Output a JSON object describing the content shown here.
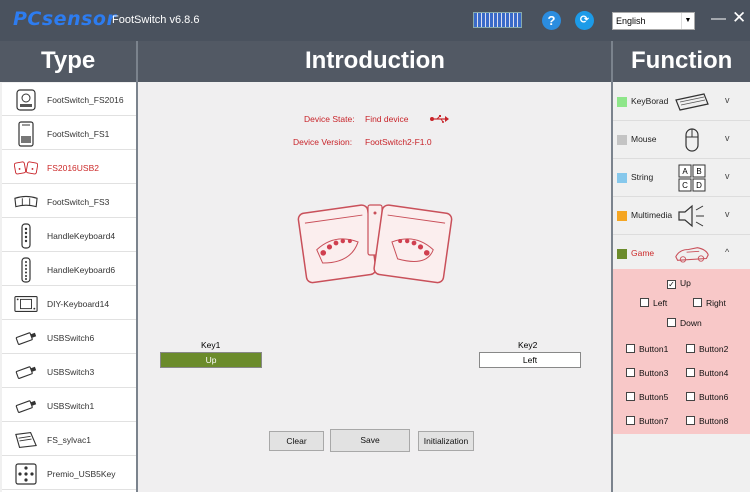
{
  "app": {
    "logo": "PCsensor",
    "title": "FootSwitch v6.8.6",
    "language": "English"
  },
  "headings": {
    "type": "Type",
    "introduction": "Introduction",
    "function": "Function"
  },
  "types": [
    {
      "label": "FootSwitch_FS2016",
      "icon": "footswitch-fs2016-icon"
    },
    {
      "label": "FootSwitch_FS1",
      "icon": "footswitch-fs1-icon"
    },
    {
      "label": "FS2016USB2",
      "icon": "fs2016usb2-icon",
      "selected": true
    },
    {
      "label": "FootSwitch_FS3",
      "icon": "footswitch-fs3-icon"
    },
    {
      "label": "HandleKeyboard4",
      "icon": "handlekeyboard4-icon"
    },
    {
      "label": "HandleKeyboard6",
      "icon": "handlekeyboard6-icon"
    },
    {
      "label": "DIY-Keyboard14",
      "icon": "diy-keyboard14-icon"
    },
    {
      "label": "USBSwitch6",
      "icon": "usbswitch6-icon"
    },
    {
      "label": "USBSwitch3",
      "icon": "usbswitch3-icon"
    },
    {
      "label": "USBSwitch1",
      "icon": "usbswitch1-icon"
    },
    {
      "label": "FS_sylvac1",
      "icon": "fs-sylvac1-icon"
    },
    {
      "label": "Premio_USB5Key",
      "icon": "premio-usb5key-icon"
    }
  ],
  "device": {
    "state_label": "Device State:",
    "state_value": "Find device",
    "version_label": "Device Version:",
    "version_value": "FootSwitch2-F1.0"
  },
  "keys": {
    "key1_label": "Key1",
    "key1_value": "Up",
    "key2_label": "Key2",
    "key2_value": "Left"
  },
  "buttons": {
    "clear": "Clear",
    "save": "Save",
    "initialization": "Initialization"
  },
  "functions": [
    {
      "label": "KeyBorad",
      "color": "#8ee68a",
      "icon": "keyboard-icon",
      "chevron": "v"
    },
    {
      "label": "Mouse",
      "color": "#c4c4c4",
      "icon": "mouse-icon",
      "chevron": "v"
    },
    {
      "label": "String",
      "color": "#86c8ec",
      "icon": "abcd-icon",
      "chevron": "v"
    },
    {
      "label": "Multimedia",
      "color": "#f5a623",
      "icon": "speaker-icon",
      "chevron": "v"
    },
    {
      "label": "Game",
      "color": "#6b8b2b",
      "icon": "race-car-icon",
      "chevron": "^",
      "active": true
    }
  ],
  "game_options": {
    "up": "Up",
    "left": "Left",
    "right": "Right",
    "down": "Down",
    "button1": "Button1",
    "button2": "Button2",
    "button3": "Button3",
    "button4": "Button4",
    "button5": "Button5",
    "button6": "Button6",
    "button7": "Button7",
    "button8": "Button8",
    "checked": [
      "up"
    ]
  },
  "colors": {
    "accent_red": "#c8242a",
    "game_panel_bg": "#f8c8c8",
    "key_selected_bg": "#6b8b2b"
  }
}
